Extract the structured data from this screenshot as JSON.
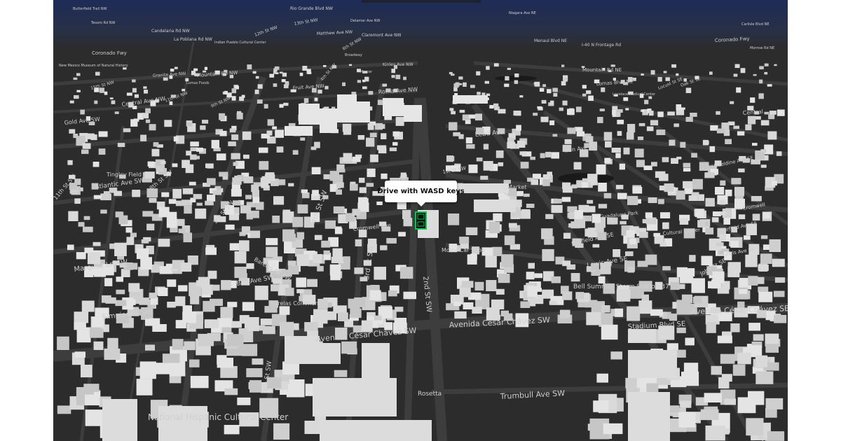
{
  "tooltip": {
    "text": "Drive with WASD keys"
  },
  "colors": {
    "ground": "#2c2c2c",
    "sky_top": "#1d2b57",
    "road": "#3d3d3d",
    "building": "#d9d9d9",
    "label": "#cfcfcf",
    "vehicle": "#00c853"
  },
  "icons": {
    "vehicle": "car-marker-icon"
  },
  "map_labels": [
    {
      "id": "fourth-st-sw-bottom",
      "text": "4th St SW"
    },
    {
      "id": "third-st-sw",
      "text": "3rd St SW"
    },
    {
      "id": "second-st-sw",
      "text": "2nd St SW"
    },
    {
      "id": "fourth-st-sw",
      "text": "4th St SW"
    },
    {
      "id": "avenida-chavez-left",
      "text": "Avenida César Chávez SW"
    },
    {
      "id": "avenida-chavez-mid",
      "text": "Avenida César Chávez SW"
    },
    {
      "id": "avenida-chavez-se",
      "text": "Avenida César Chávez SE"
    },
    {
      "id": "trumbull-ave",
      "text": "Trumbull Ave SW"
    },
    {
      "id": "stadium-blvd",
      "text": "Stadium Blvd SE"
    },
    {
      "id": "williams",
      "text": "Williams"
    },
    {
      "id": "national-hispanic",
      "text": "National Hispanic Cultural Center"
    },
    {
      "id": "motor-car-shop",
      "text": "Motor Car Shop"
    },
    {
      "id": "bell-storm",
      "text": "Bell Summer Storm Station 37"
    },
    {
      "id": "garfield-ave-se",
      "text": "Garfield Ave SE"
    },
    {
      "id": "lewis-ave-se",
      "text": "Lewis Ave SE"
    },
    {
      "id": "john-st-se",
      "text": "John St SE"
    },
    {
      "id": "lead-ave",
      "text": "Lead Ave"
    },
    {
      "id": "iron-ave-se",
      "text": "Iron Ave SE"
    },
    {
      "id": "market",
      "text": "Market"
    },
    {
      "id": "atlantic-ave",
      "text": "Atlantic Ave SW"
    },
    {
      "id": "tingley-field",
      "text": "Tingley Field"
    },
    {
      "id": "marquez-ln",
      "text": "Marquez Ln SW"
    },
    {
      "id": "simpier-ln",
      "text": "Simpier Ln SW"
    },
    {
      "id": "bell-ave-sw",
      "text": "Bell Ave SW"
    },
    {
      "id": "barelas-rd",
      "text": "Barelas Rd SW"
    },
    {
      "id": "barelas-community",
      "text": "Barelas Community"
    },
    {
      "id": "gold-ave",
      "text": "Gold Ave SW"
    },
    {
      "id": "central-ave-nw",
      "text": "Central Ave NW"
    },
    {
      "id": "central",
      "text": "Central"
    },
    {
      "id": "roma-ave",
      "text": "Roma Ave NW"
    },
    {
      "id": "fruit-ave",
      "text": "Fruit Ave NW"
    },
    {
      "id": "lomas-blvd-ne",
      "text": "Lomas Blvd NE"
    },
    {
      "id": "mountain-rd-ne",
      "text": "Mountain Rd NE"
    },
    {
      "id": "mountain-rd-nw",
      "text": "Mountain Rd NW"
    },
    {
      "id": "granite-ave",
      "text": "Granite Ave NW"
    },
    {
      "id": "coronado-fwy-left",
      "text": "Coronado Fwy"
    },
    {
      "id": "coronado-fwy-right",
      "text": "Coronado Fwy"
    },
    {
      "id": "menaul-blvd",
      "text": "Menaul Blvd NE"
    },
    {
      "id": "i40-frontage",
      "text": "I-40 N Frontage Rd"
    },
    {
      "id": "matthew-ave",
      "text": "Matthew Ave NW"
    },
    {
      "id": "claremont-ave",
      "text": "Claremont Ave NW"
    },
    {
      "id": "kinley-ave",
      "text": "Kinley Ave NW"
    },
    {
      "id": "candelaria-rd",
      "text": "Candelaria Rd NW"
    },
    {
      "id": "la-poblana",
      "text": "La Poblana Rd NW"
    },
    {
      "id": "twelfth-st",
      "text": "12th St NW"
    },
    {
      "id": "thirteenth-st",
      "text": "13th St NW"
    },
    {
      "id": "eleventh-st",
      "text": "11th St NW"
    },
    {
      "id": "fifteenth-st",
      "text": "15th St NW"
    },
    {
      "id": "butterfield-trail",
      "text": "Butterfield Trail NW"
    },
    {
      "id": "tesoro-rd",
      "text": "Tesoro Rd NW"
    },
    {
      "id": "rio-grande-blvd",
      "text": "Rio Grande Blvd NW"
    },
    {
      "id": "delamar-ave",
      "text": "Delamar Ave NW"
    },
    {
      "id": "niagara-ave",
      "text": "Niagara Ave NE"
    },
    {
      "id": "carlisle-blvd",
      "text": "Carlisle Blvd NE"
    },
    {
      "id": "indian-pueblo",
      "text": "Indian Pueblo Cultural Center"
    },
    {
      "id": "oak-st-se",
      "text": "Oak St SE"
    },
    {
      "id": "locust-st-se",
      "text": "Locust St SE"
    },
    {
      "id": "lovelace-medical",
      "text": "Lovelace Medical Center"
    },
    {
      "id": "morrow-rd",
      "text": "Morrow Rd NE"
    },
    {
      "id": "guadalupe-park",
      "text": "Guadalupe Park"
    },
    {
      "id": "cultural-center",
      "text": "Cultural Center"
    },
    {
      "id": "cromwell-ave",
      "text": "Cromwell Ave"
    },
    {
      "id": "cromwell-ave-se",
      "text": "Cromwell"
    },
    {
      "id": "new-mexico-museum",
      "text": "New Mexico Museum of Natural History"
    },
    {
      "id": "lomas-foods",
      "text": "Lomas Foods"
    },
    {
      "id": "ninth-st",
      "text": "9th St NW"
    },
    {
      "id": "sixth-st",
      "text": "6th St NW"
    },
    {
      "id": "broadway",
      "text": "Broadway"
    },
    {
      "id": "mercer",
      "text": "Mercer"
    },
    {
      "id": "garfield-ave-se-right",
      "text": "Garfield Ave SE"
    },
    {
      "id": "lewis-ave-se-right",
      "text": "Lewis Ave SE"
    },
    {
      "id": "hazeldine",
      "text": "Hazeldine Ave SE"
    },
    {
      "id": "fourth-st-nw",
      "text": "4th St NW"
    },
    {
      "id": "eighth-st",
      "text": "8th St SW"
    },
    {
      "id": "first-st",
      "text": "1st St SW"
    },
    {
      "id": "fifth-st",
      "text": "5th St SW"
    },
    {
      "id": "eleventh-st-sw",
      "text": "11th St SW"
    },
    {
      "id": "rosetta",
      "text": "Rosetta"
    }
  ]
}
